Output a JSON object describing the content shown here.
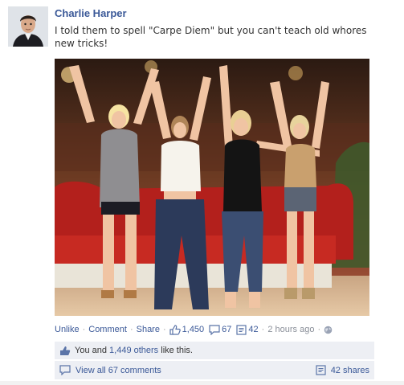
{
  "post": {
    "author": "Charlie Harper",
    "message": "I told them to spell \"Carpe Diem\" but you can't teach old whores new tricks!",
    "avatar_icon": "person-avatar-icon",
    "photo_icon": "group-photo-image"
  },
  "actions": {
    "unlike": "Unlike",
    "comment": "Comment",
    "share": "Share",
    "like_count": "1,450",
    "comment_count": "67",
    "share_count": "42",
    "time": "2 hours ago",
    "separator": "·"
  },
  "likes": {
    "prefix": "You and ",
    "others_link": "1,449 others",
    "suffix": " like this."
  },
  "comments": {
    "view_all": "View all 67 comments",
    "shares": "42 shares"
  },
  "colors": {
    "link": "#3b5998",
    "meta": "#8a8f99",
    "box_bg": "#edeff4"
  }
}
